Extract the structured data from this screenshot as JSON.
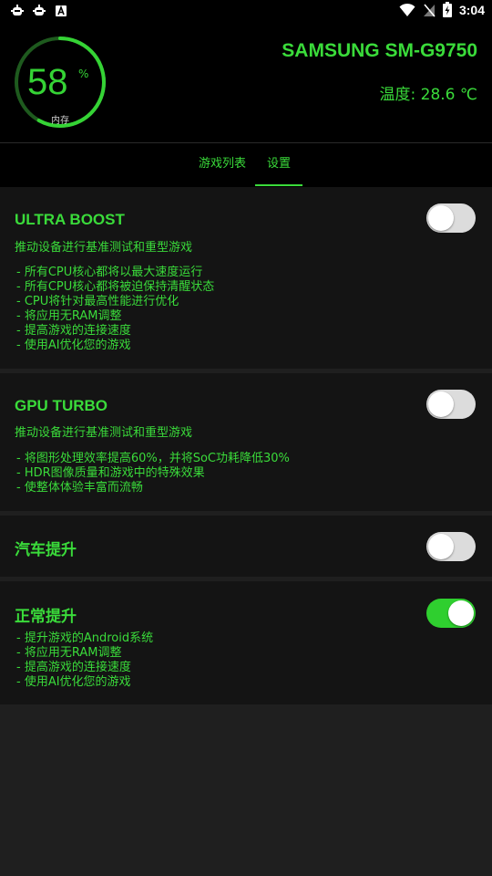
{
  "status_bar": {
    "time": "3:04",
    "left_icons": [
      "notification-bug-icon",
      "notification-bug-icon",
      "notification-a-icon"
    ],
    "right_icons": [
      "wifi-icon",
      "no-signal-icon",
      "battery-charging-icon"
    ]
  },
  "header": {
    "memory_percent": "58",
    "memory_percent_value": 0.58,
    "percent_sign": "%",
    "memory_label": "内存",
    "device_name": "SAMSUNG SM-G9750",
    "temperature": "温度: 28.6 ℃"
  },
  "tabs": [
    {
      "label": "游戏列表",
      "selected": false
    },
    {
      "label": "设置",
      "selected": true
    }
  ],
  "cards": {
    "ultra_boost": {
      "title": "ULTRA BOOST",
      "subtitle": "推动设备进行基准测试和重型游戏",
      "toggle_on": false,
      "features": [
        "- 所有CPU核心都将以最大速度运行",
        "- 所有CPU核心都将被迫保持清醒状态",
        "-  CPU将针对最高性能进行优化",
        "- 将应用无RAM调整",
        "- 提高游戏的连接速度",
        "- 使用AI优化您的游戏"
      ]
    },
    "gpu_turbo": {
      "title": "GPU TURBO",
      "subtitle": "推动设备进行基准测试和重型游戏",
      "toggle_on": false,
      "features": [
        "- 将图形处理效率提高60%，并将SoC功耗降低30%",
        "-  HDR图像质量和游戏中的特殊效果",
        "- 使整体体验丰富而流畅"
      ]
    },
    "car_boost": {
      "title": "汽车提升",
      "toggle_on": false
    },
    "normal_boost": {
      "title": "正常提升",
      "toggle_on": true,
      "features": [
        "- 提升游戏的Android系统",
        "- 将应用无RAM调整",
        "- 提高游戏的连接速度",
        "- 使用AI优化您的游戏"
      ]
    }
  },
  "colors": {
    "accent": "#3adb3a",
    "toggle_on": "#2fcf2f",
    "toggle_off": "#dcdcdc",
    "card_bg": "#141414",
    "page_bg": "#1f1f1f"
  }
}
